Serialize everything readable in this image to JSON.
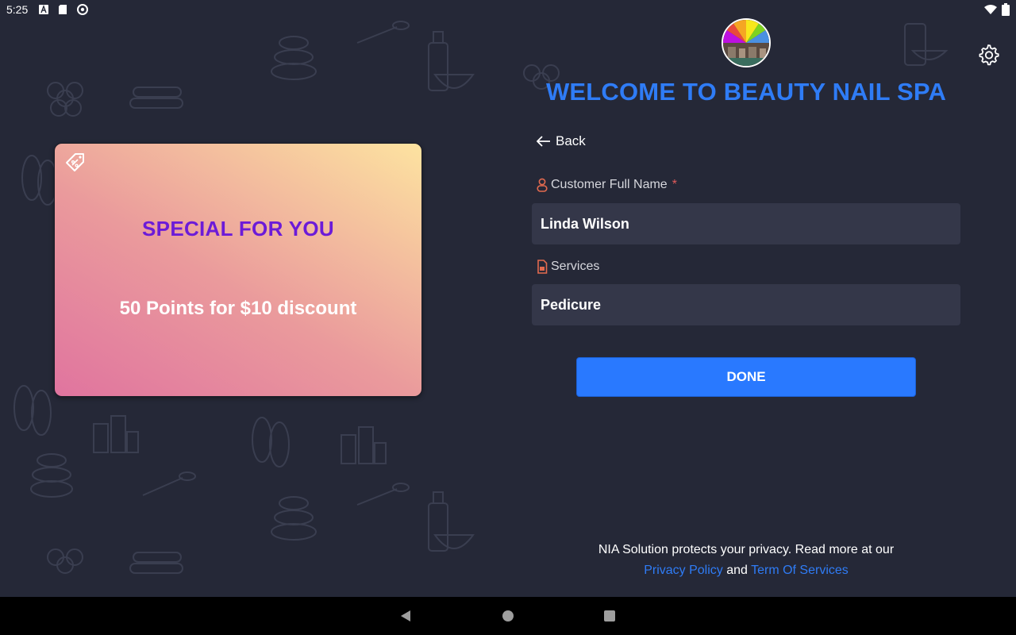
{
  "status_bar": {
    "time": "5:25",
    "left_icons": [
      "accessibility-a-icon",
      "sd-card-icon",
      "sync-circle-icon"
    ],
    "right_icons": [
      "wifi-icon",
      "battery-icon"
    ]
  },
  "promo": {
    "icon": "discount-tag-icon",
    "title": "SPECIAL FOR YOU",
    "text": "50 Points for $10 discount",
    "gradient": [
      "#e0749f",
      "#ea9a9c",
      "#fde3a0"
    ]
  },
  "header": {
    "welcome": "WELCOME TO BEAUTY NAIL SPA",
    "settings_icon": "gear-icon"
  },
  "back": {
    "label": "Back"
  },
  "form": {
    "name_label": "Customer Full Name",
    "name_required": "*",
    "name_value": "Linda Wilson",
    "services_label": "Services",
    "services_value": "Pedicure"
  },
  "done_label": "DONE",
  "privacy": {
    "text": "NIA Solution protects your privacy. Read more at our",
    "privacy_link": "Privacy Policy",
    "and": "and",
    "terms_link": "Term Of Services"
  },
  "colors": {
    "background": "#252837",
    "accent": "#2f7cf6",
    "button": "#2979ff",
    "input_bg": "#343749",
    "promo_title": "#6c1bd8",
    "required": "#e25b5b"
  }
}
